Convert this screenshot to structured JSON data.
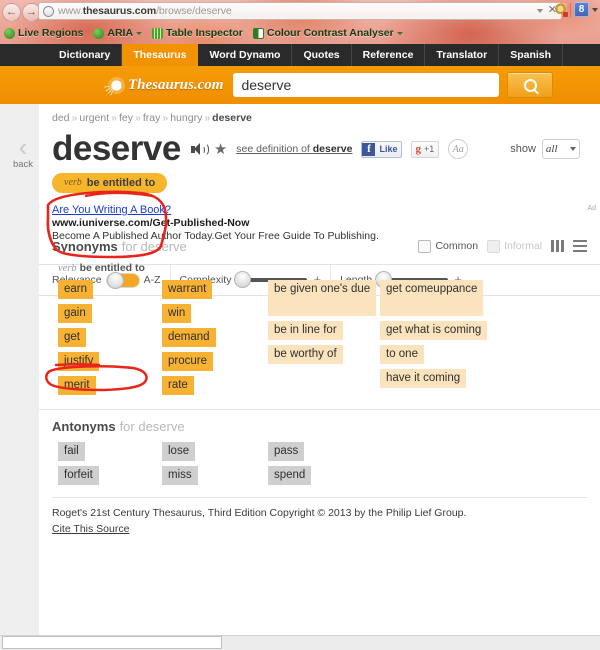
{
  "browser": {
    "url_prefix": "www.",
    "url_domain": "thesaurus.com",
    "url_path": "/browse/deserve",
    "back_icon": "back-arrow-icon",
    "forward_icon": "forward-arrow-icon",
    "stop_label": "✕",
    "addons": [
      {
        "label": "Live Regions",
        "icon": "live-regions-icon",
        "caret": false
      },
      {
        "label": "ARIA",
        "icon": "aria-icon",
        "caret": true
      },
      {
        "label": "Table Inspector",
        "icon": "table-inspector-icon",
        "caret": false
      },
      {
        "label": "Colour Contrast Analyser",
        "icon": "colour-contrast-analyser-icon",
        "caret": true
      }
    ],
    "toolbar_icons": [
      "settings-icon",
      "bookmark-icon"
    ],
    "extension_badge": "8"
  },
  "sitenav": {
    "tabs": [
      {
        "label": "Dictionary",
        "active": false
      },
      {
        "label": "Thesaurus",
        "active": true
      },
      {
        "label": "Word Dynamo",
        "active": false
      },
      {
        "label": "Quotes",
        "active": false
      },
      {
        "label": "Reference",
        "active": false
      },
      {
        "label": "Translator",
        "active": false
      },
      {
        "label": "Spanish",
        "active": false
      }
    ]
  },
  "header": {
    "brand": "Thesaurus.com",
    "search_value": "deserve",
    "search_placeholder": "",
    "search_button_icon": "magnifier-icon"
  },
  "breadcrumb": {
    "items": [
      "ded",
      "urgent",
      "fey",
      "fray",
      "hungry"
    ],
    "current": "deserve",
    "separator": "»"
  },
  "entry": {
    "back_label": "back",
    "word": "deserve",
    "speaker_icon": "speaker-icon",
    "star_icon": "star-icon",
    "see_definition_prefix": "see definition of ",
    "see_definition_word": "deserve",
    "facebook_label": "Like",
    "facebook_glyph": "f",
    "gplus_glyph": "g",
    "gplus_count": "+1",
    "font_button": "Aa",
    "show_label": "show",
    "show_value": "all",
    "pos_chip": {
      "pos": "verb",
      "sense": "be entitled to"
    }
  },
  "ad": {
    "title": "Are You Writing A Book?",
    "url": "www.iuniverse.com/Get-Published-Now",
    "description": "Become A Published Author Today.Get Your Free Guide To Publishing.",
    "tag": "Ad"
  },
  "controls": {
    "relevance_label": "Relevance",
    "az_label": "A-Z",
    "complexity_label": "Complexity",
    "length_label": "Length",
    "plus_label": "+"
  },
  "synonyms": {
    "title": "Synonyms",
    "subtitle": "for deserve",
    "common_label": "Common",
    "informal_label": "Informal",
    "view_columns_icon": "columns-view-icon",
    "view_list_icon": "list-view-icon",
    "pos": "verb",
    "sense": "be entitled to",
    "columns": [
      {
        "items": [
          {
            "text": "earn",
            "strength": "s3"
          },
          {
            "text": "gain",
            "strength": "s3"
          },
          {
            "text": "get",
            "strength": "s3"
          },
          {
            "text": "justify",
            "strength": "s3"
          },
          {
            "text": "merit",
            "strength": "s3"
          }
        ]
      },
      {
        "items": [
          {
            "text": "warrant",
            "strength": "s3"
          },
          {
            "text": "win",
            "strength": "s3"
          },
          {
            "text": "demand",
            "strength": "s3"
          },
          {
            "text": "procure",
            "strength": "s3"
          },
          {
            "text": "rate",
            "strength": "s3"
          }
        ]
      },
      {
        "items": [
          {
            "text": "be given one's due",
            "strength": "s1",
            "tall": true
          },
          {
            "text": "be in line for",
            "strength": "s1"
          },
          {
            "text": "be worthy of",
            "strength": "s1"
          }
        ]
      },
      {
        "items": [
          {
            "text": "get comeuppance",
            "strength": "s1",
            "tall": true
          },
          {
            "text": "get what is coming",
            "strength": "s1"
          },
          {
            "text": "to one",
            "strength": "s1"
          },
          {
            "text": "have it coming",
            "strength": "s1"
          }
        ]
      }
    ]
  },
  "antonyms": {
    "title": "Antonyms",
    "subtitle": "for deserve",
    "columns": [
      {
        "items": [
          {
            "text": "fail"
          },
          {
            "text": "forfeit"
          }
        ]
      },
      {
        "items": [
          {
            "text": "lose"
          },
          {
            "text": "miss"
          }
        ]
      },
      {
        "items": [
          {
            "text": "pass"
          },
          {
            "text": "spend"
          }
        ]
      }
    ]
  },
  "footer": {
    "copyright": "Roget's 21st Century Thesaurus, Third Edition Copyright © 2013 by the Philip Lief Group.",
    "cite_link": "Cite This Source"
  },
  "colors": {
    "brand_orange": "#f39200",
    "chip_strong": "#f7b233",
    "chip_weak": "#fbe3bd",
    "antonym_chip": "#cfcfcf",
    "nav_dark": "#2a2a2a",
    "annotation_red": "#e8251a"
  }
}
